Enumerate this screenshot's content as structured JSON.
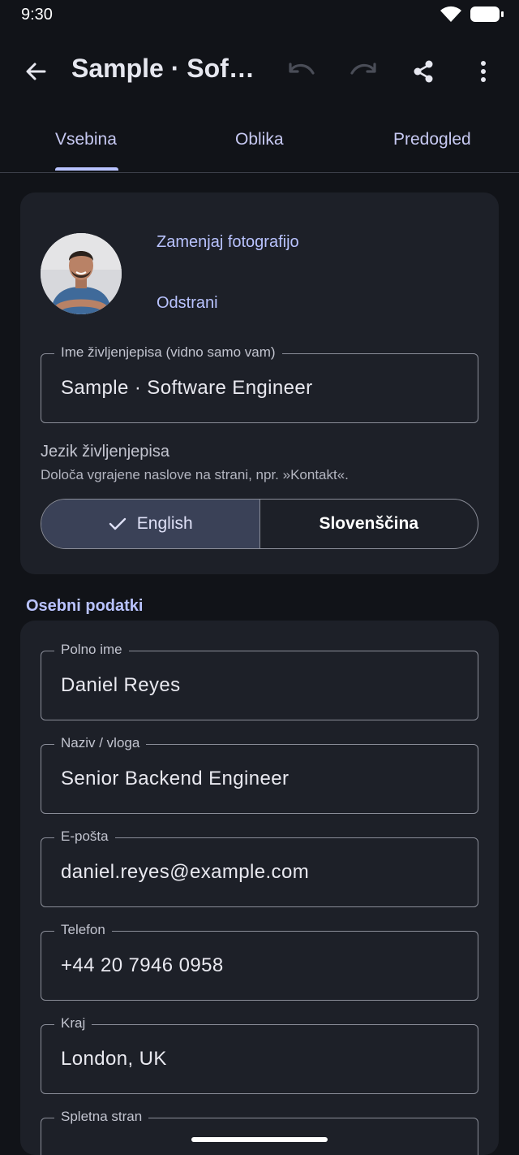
{
  "status_bar": {
    "time": "9:30"
  },
  "app_bar": {
    "title": "Sample · Soft…",
    "icons": [
      "back-arrow-icon",
      "undo-icon",
      "redo-icon",
      "share-icon",
      "more-vert-icon"
    ]
  },
  "tabs": [
    {
      "label": "Vsebina",
      "selected": true
    },
    {
      "label": "Oblika",
      "selected": false
    },
    {
      "label": "Predogled",
      "selected": false
    }
  ],
  "photo": {
    "replace_label": "Zamenjaj fotografijo",
    "remove_label": "Odstrani"
  },
  "resume_name": {
    "label": "Ime življenjepisa (vidno samo vam)",
    "value": "Sample · Software Engineer"
  },
  "language": {
    "title": "Jezik življenjepisa",
    "subtitle": "Določa vgrajene naslove na strani, npr. »Kontakt«.",
    "options": [
      {
        "label": "English",
        "selected": true
      },
      {
        "label": "Slovenščina",
        "selected": false
      }
    ]
  },
  "personal": {
    "section_title": "Osebni podatki",
    "fields": [
      {
        "label": "Polno ime",
        "value": "Daniel Reyes"
      },
      {
        "label": "Naziv / vloga",
        "value": "Senior Backend Engineer"
      },
      {
        "label": "E-pošta",
        "value": "daniel.reyes@example.com"
      },
      {
        "label": "Telefon",
        "value": "+44 20 7946 0958"
      },
      {
        "label": "Kraj",
        "value": "London, UK"
      },
      {
        "label": "Spletna stran",
        "value": ""
      }
    ]
  },
  "colors": {
    "background": "#111318",
    "card": "#1d2028",
    "accent": "#b9c3ff",
    "selected_segment": "#3a4157"
  }
}
